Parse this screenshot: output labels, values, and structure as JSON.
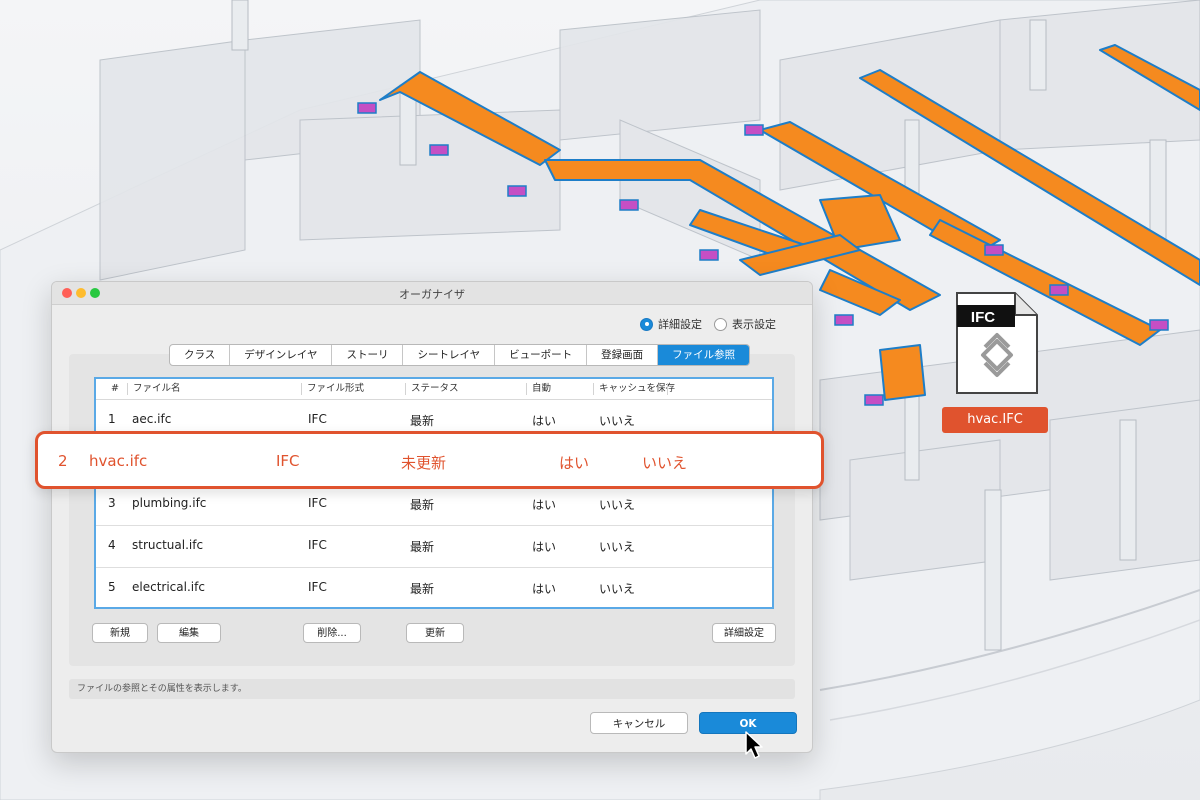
{
  "dialog": {
    "title": "オーガナイザ",
    "radio": [
      {
        "label": "詳細設定",
        "selected": true
      },
      {
        "label": "表示設定",
        "selected": false
      }
    ],
    "tabs": [
      "クラス",
      "デザインレイヤ",
      "ストーリ",
      "シートレイヤ",
      "ビューポート",
      "登録画面",
      "ファイル参照"
    ],
    "active_tab": "ファイル参照",
    "table": {
      "headers": [
        "#",
        "ファイル名",
        "ファイル形式",
        "ステータス",
        "自動",
        "キャッシュを保存"
      ],
      "rows": [
        {
          "num": "1",
          "name": "aec.ifc",
          "format": "IFC",
          "status": "最新",
          "auto": "はい",
          "cache": "いいえ"
        },
        {
          "num": "2",
          "name": "hvac.ifc",
          "format": "IFC",
          "status": "未更新",
          "auto": "はい",
          "cache": "いいえ"
        },
        {
          "num": "3",
          "name": "plumbing.ifc",
          "format": "IFC",
          "status": "最新",
          "auto": "はい",
          "cache": "いいえ"
        },
        {
          "num": "4",
          "name": "structual.ifc",
          "format": "IFC",
          "status": "最新",
          "auto": "はい",
          "cache": "いいえ"
        },
        {
          "num": "5",
          "name": "electrical.ifc",
          "format": "IFC",
          "status": "最新",
          "auto": "はい",
          "cache": "いいえ"
        }
      ]
    },
    "buttons": {
      "new": "新規",
      "edit": "編集",
      "delete": "削除...",
      "update": "更新",
      "details": "詳細設定"
    },
    "status_text": "ファイルの参照とその属性を表示します。",
    "cancel": "キャンセル",
    "ok": "OK"
  },
  "ifc_badge": {
    "icon_label": "IFC",
    "file_name": "hvac.IFC"
  },
  "colors": {
    "accent": "#1a8ad9",
    "highlight": "#e0532e",
    "duct": "#f58a1f"
  }
}
